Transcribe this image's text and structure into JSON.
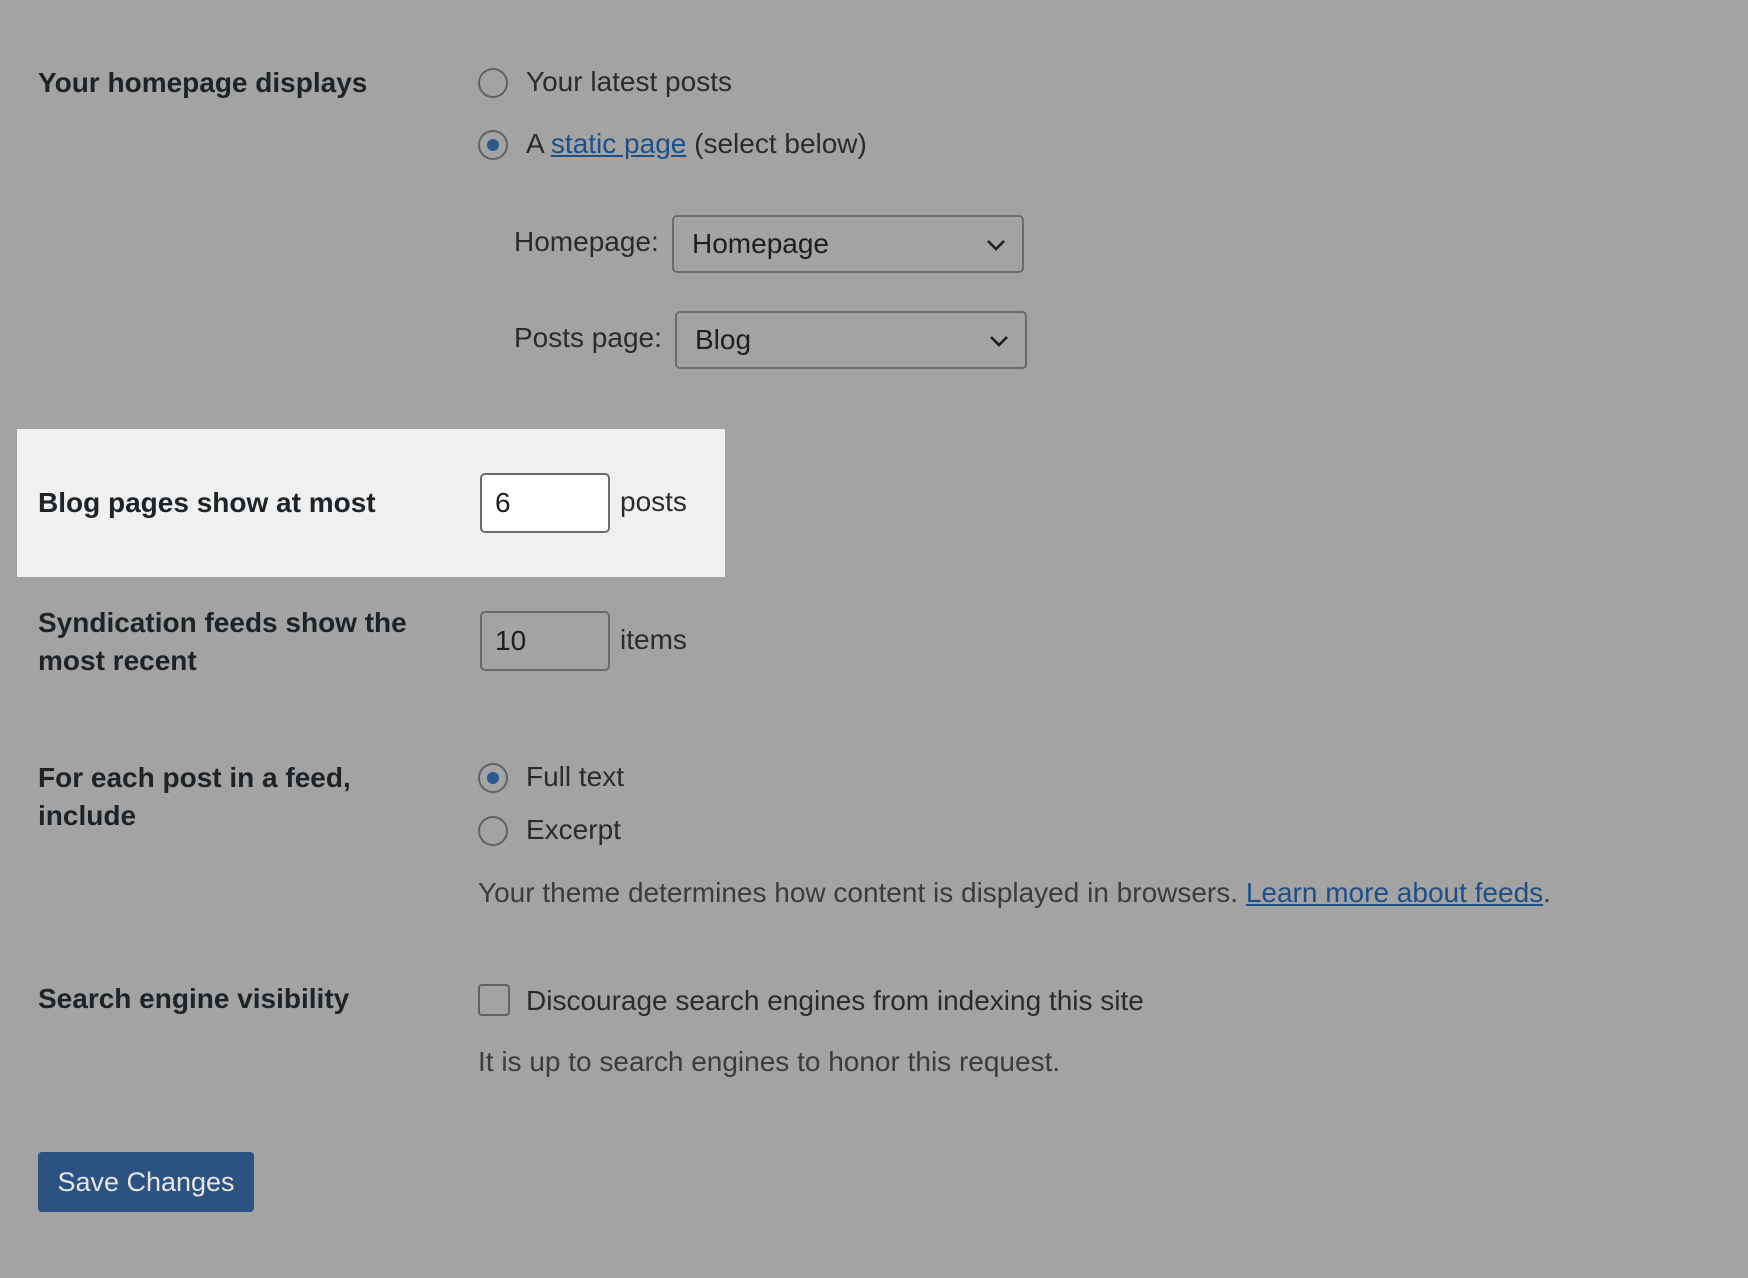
{
  "homepage_displays": {
    "label": "Your homepage displays",
    "option_latest": "Your latest posts",
    "option_static_prefix": "A",
    "option_static_link": "static page",
    "option_static_suffix": "(select below)",
    "selected": "static",
    "homepage_label": "Homepage:",
    "homepage_value": "Homepage",
    "posts_page_label": "Posts page:",
    "posts_page_value": "Blog"
  },
  "blog_pages": {
    "label": "Blog pages show at most",
    "value": "6",
    "unit": "posts"
  },
  "syndication": {
    "label": "Syndication feeds show the most recent",
    "value": "10",
    "unit": "items"
  },
  "feed_content": {
    "label": "For each post in a feed, include",
    "option_full": "Full text",
    "option_excerpt": "Excerpt",
    "selected": "full",
    "description": "Your theme determines how content is displayed in browsers.",
    "learn_more": "Learn more about feeds",
    "period": "."
  },
  "search_visibility": {
    "label": "Search engine visibility",
    "checkbox_label": "Discourage search engines from indexing this site",
    "checked": false,
    "description": "It is up to search engines to honor this request."
  },
  "save_button": "Save Changes",
  "colors": {
    "background": "#a3a3a3",
    "highlight": "#f0f0f0",
    "accent": "#2c5282",
    "link": "#1f4f86"
  }
}
